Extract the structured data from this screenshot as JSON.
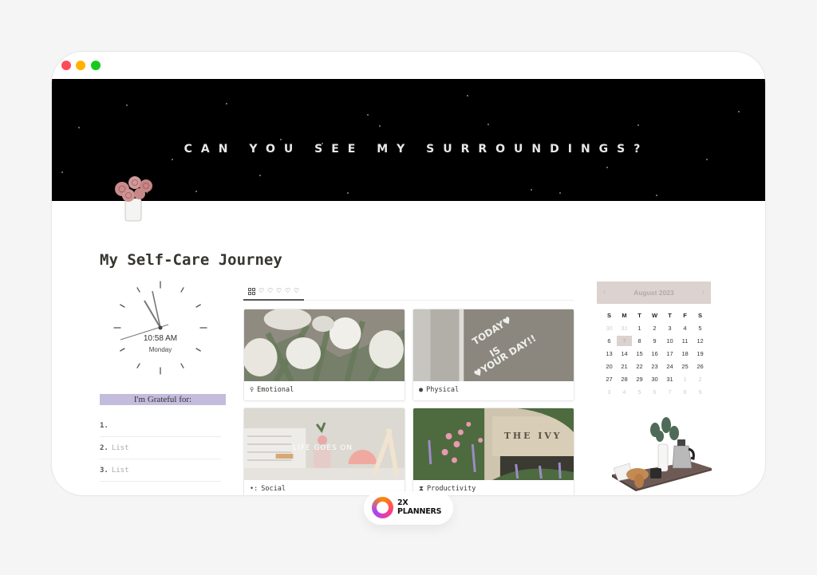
{
  "window": {
    "controls": [
      "close",
      "minimize",
      "maximize"
    ]
  },
  "banner": {
    "text": "CAN YOU SEE MY SURROUNDINGS?"
  },
  "page": {
    "icon": "rose-vase-icon",
    "title": "My Self-Care Journey"
  },
  "clock": {
    "time": "10:58 AM",
    "day": "Monday"
  },
  "grateful": {
    "heading": "I'm Grateful for:",
    "items": [
      {
        "num": "1.",
        "text": ""
      },
      {
        "num": "2.",
        "text": "List"
      },
      {
        "num": "3.",
        "text": "List"
      }
    ]
  },
  "gallery": {
    "view_tabs": [
      "gallery-grid-icon",
      "heart-icon",
      "heart-icon",
      "heart-icon",
      "heart-icon",
      "heart-icon"
    ],
    "tab_glyph": "♡",
    "cards": [
      {
        "icon": "♀",
        "icon_name": "female-sign-icon",
        "label": "Emotional",
        "image": "white tulips"
      },
      {
        "icon": "●",
        "icon_name": "apple-icon",
        "label": "Physical",
        "image": "TODAY IS YOUR DAY!! mirror"
      },
      {
        "icon": "•:",
        "icon_name": "people-icon",
        "label": "Social",
        "image": "LIFE GOES ON"
      },
      {
        "icon": "⧗",
        "icon_name": "hourglass-icon",
        "label": "Productivity",
        "image": "THE IVY"
      }
    ],
    "image_texts": {
      "physical": [
        "TODAY♥",
        "IS",
        "♥YOUR DAY!!"
      ],
      "social": "LIFE GOES ON",
      "productivity": "THE IVY"
    }
  },
  "calendar": {
    "month": "August 2023",
    "prev": "‹",
    "next": "›",
    "weekdays": [
      "S",
      "M",
      "T",
      "W",
      "T",
      "F",
      "S"
    ],
    "days": [
      {
        "d": "30",
        "m": true
      },
      {
        "d": "31",
        "m": true
      },
      {
        "d": "1"
      },
      {
        "d": "2"
      },
      {
        "d": "3"
      },
      {
        "d": "4"
      },
      {
        "d": "5"
      },
      {
        "d": "6"
      },
      {
        "d": "7",
        "today": true
      },
      {
        "d": "8"
      },
      {
        "d": "9"
      },
      {
        "d": "10"
      },
      {
        "d": "11"
      },
      {
        "d": "12"
      },
      {
        "d": "13"
      },
      {
        "d": "14"
      },
      {
        "d": "15"
      },
      {
        "d": "16"
      },
      {
        "d": "17"
      },
      {
        "d": "18"
      },
      {
        "d": "19"
      },
      {
        "d": "20"
      },
      {
        "d": "21"
      },
      {
        "d": "22"
      },
      {
        "d": "23"
      },
      {
        "d": "24"
      },
      {
        "d": "25"
      },
      {
        "d": "26"
      },
      {
        "d": "27"
      },
      {
        "d": "28"
      },
      {
        "d": "29"
      },
      {
        "d": "30"
      },
      {
        "d": "31"
      },
      {
        "d": "1",
        "m": true
      },
      {
        "d": "2",
        "m": true
      },
      {
        "d": "3",
        "m": true
      },
      {
        "d": "4",
        "m": true
      },
      {
        "d": "5",
        "m": true
      },
      {
        "d": "6",
        "m": true
      },
      {
        "d": "7",
        "m": true
      },
      {
        "d": "8",
        "m": true
      },
      {
        "d": "9",
        "m": true
      }
    ]
  },
  "decor": {
    "tray": "breakfast-tray-illustration"
  },
  "badge": {
    "line1": "2X",
    "line2": "PLANNERS"
  },
  "colors": {
    "grateful_heading_bg": "#c4bcdc",
    "calendar_accent": "#dcd2cf",
    "banner_bg": "#000000"
  }
}
